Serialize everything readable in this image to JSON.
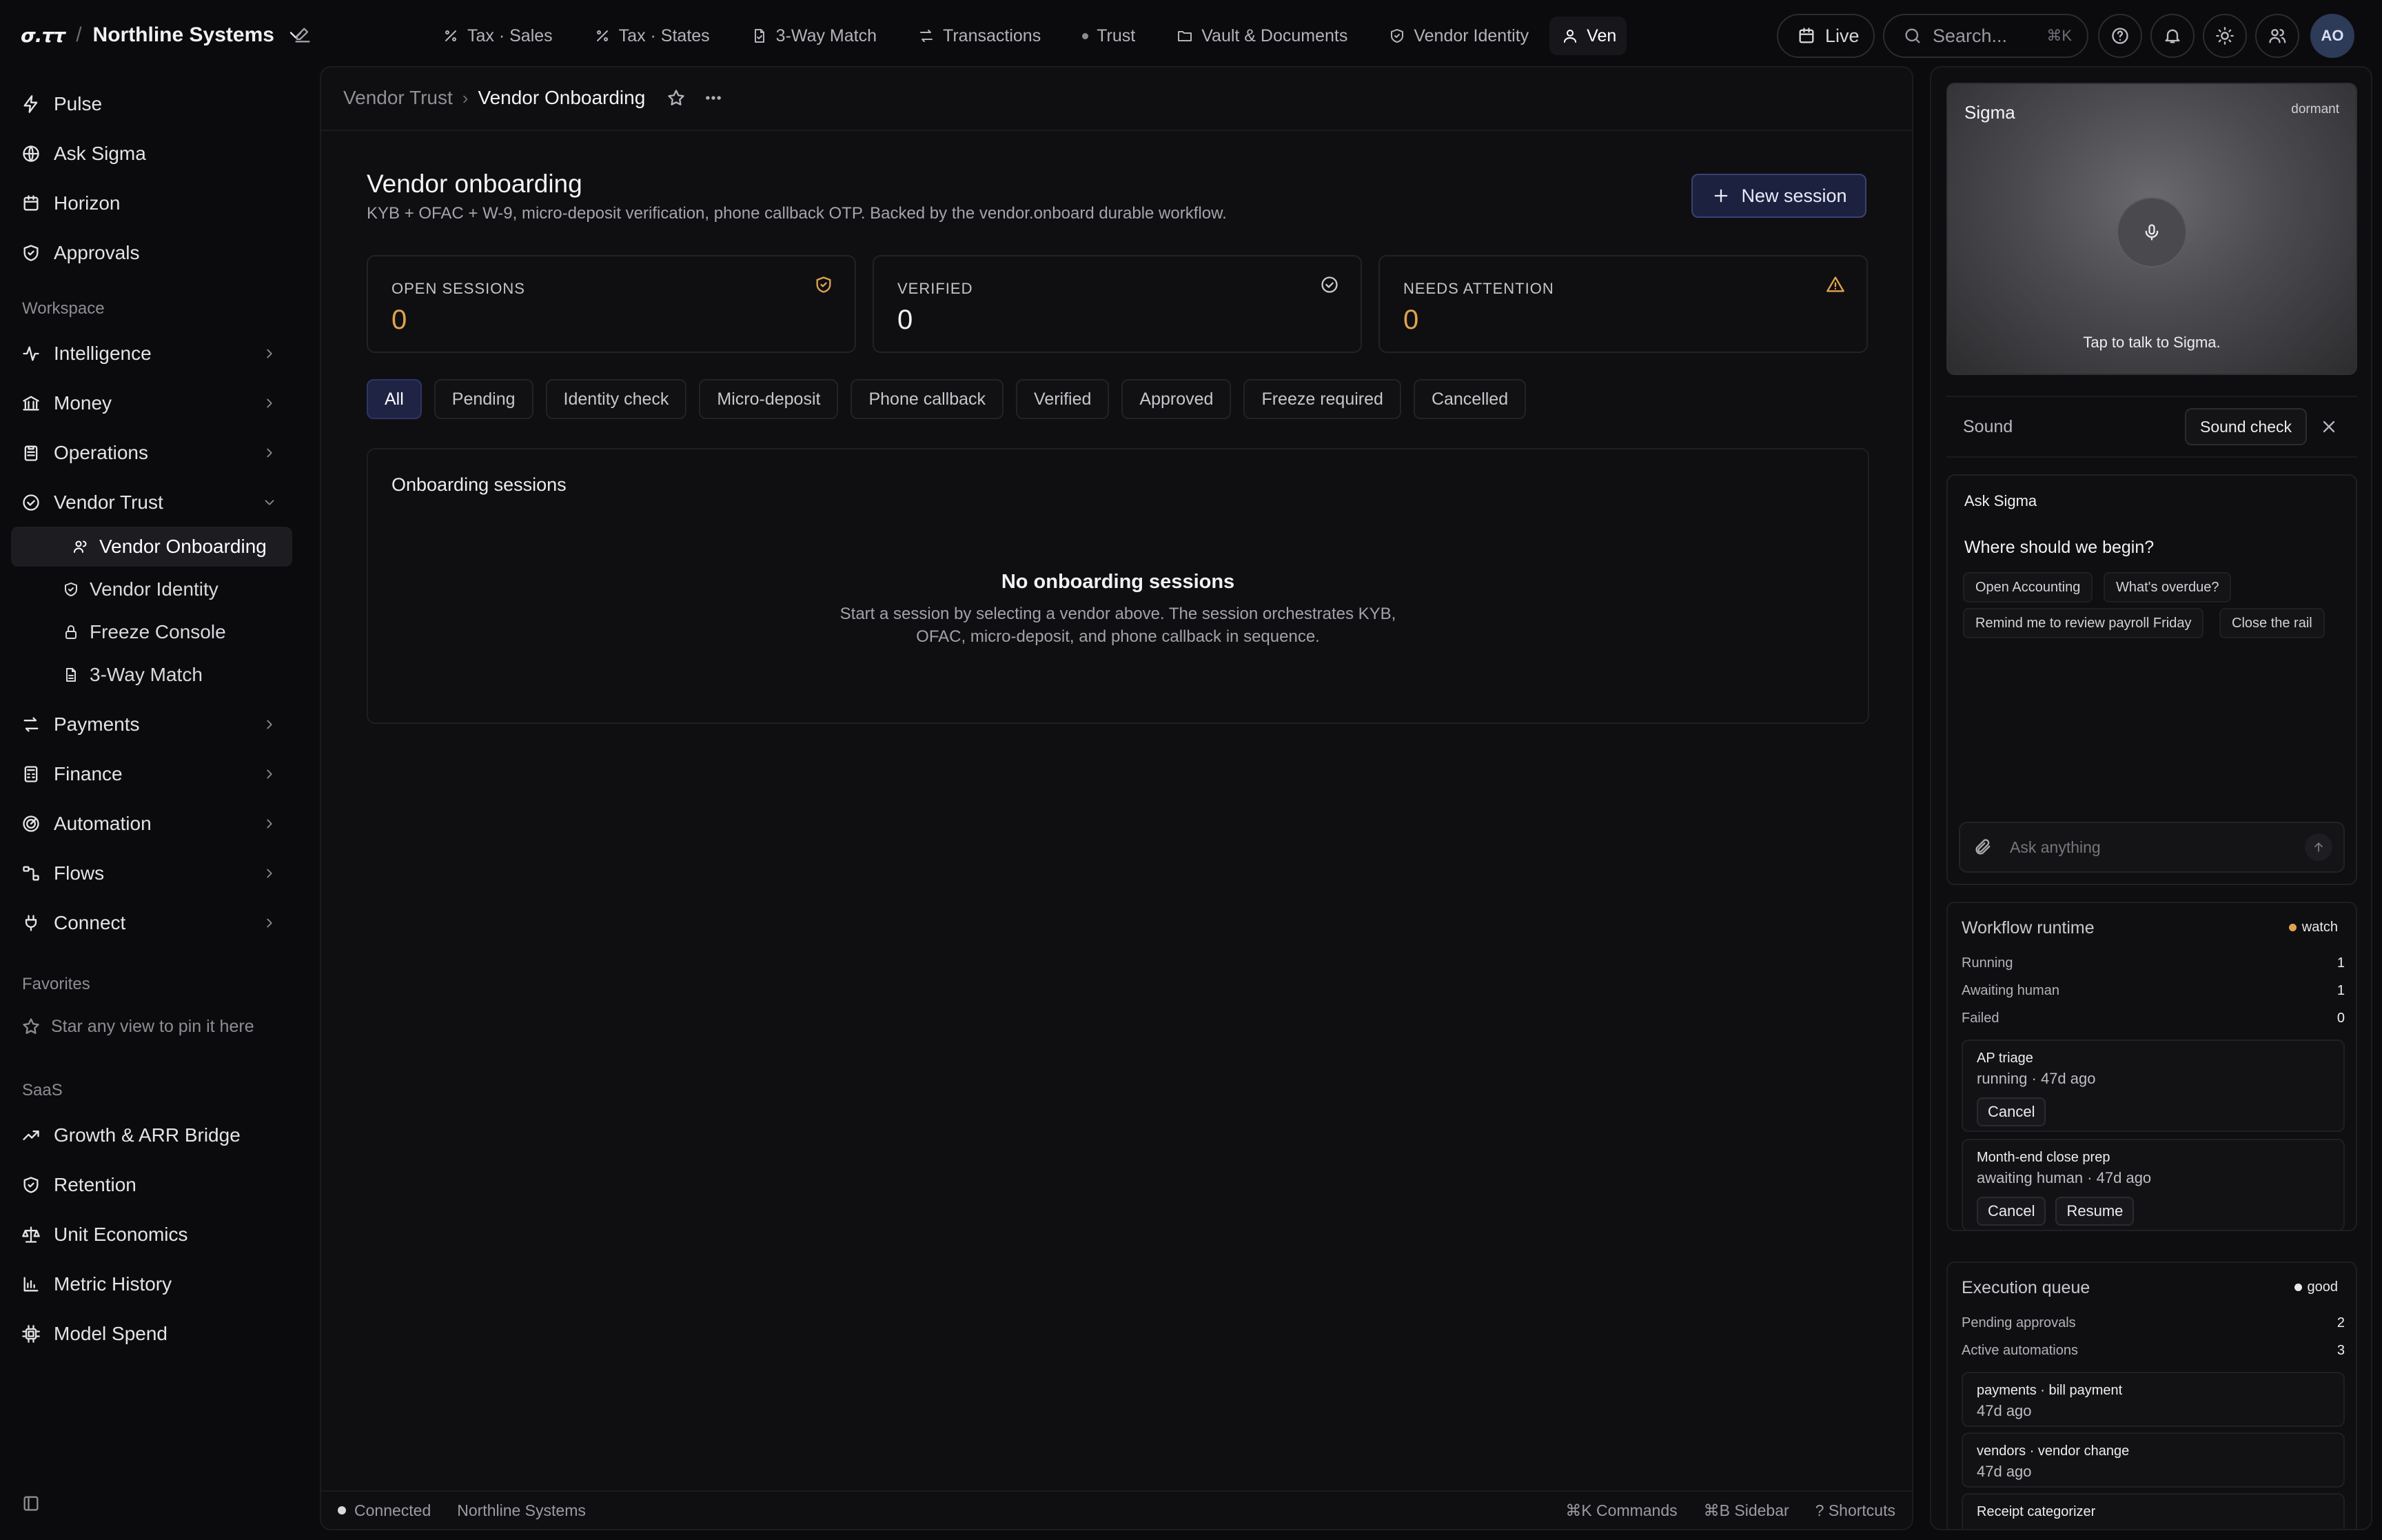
{
  "app": {
    "logo": "σ.ττ",
    "org_name": "Northline Systems"
  },
  "topnav": {
    "tabs": [
      {
        "label": "Tax · Sales",
        "icon": "percent-icon"
      },
      {
        "label": "Tax · States",
        "icon": "percent-icon"
      },
      {
        "label": "3-Way Match",
        "icon": "file-icon"
      },
      {
        "label": "Transactions",
        "icon": "arrows-icon"
      },
      {
        "label": "Trust",
        "icon": "dot-icon"
      },
      {
        "label": "Vault & Documents",
        "icon": "folder-icon"
      },
      {
        "label": "Vendor Identity",
        "icon": "shield-icon"
      },
      {
        "label": "Ven",
        "icon": "user-icon"
      }
    ],
    "live_label": "Live",
    "search_placeholder": "Search...",
    "search_shortcut": "⌘K",
    "avatar_initials": "AO"
  },
  "sidebar": {
    "top_items": [
      {
        "label": "Pulse",
        "icon": "bolt-icon"
      },
      {
        "label": "Ask Sigma",
        "icon": "sparkle-icon"
      },
      {
        "label": "Horizon",
        "icon": "calendar-icon"
      },
      {
        "label": "Approvals",
        "icon": "shield-check-icon"
      }
    ],
    "workspace_label": "Workspace",
    "workspace_items": [
      {
        "label": "Intelligence",
        "icon": "activity-icon"
      },
      {
        "label": "Money",
        "icon": "bank-icon"
      },
      {
        "label": "Operations",
        "icon": "clipboard-icon"
      },
      {
        "label": "Vendor Trust",
        "icon": "badge-check-icon"
      }
    ],
    "vendor_trust_children": [
      {
        "label": "Vendor Onboarding",
        "icon": "user-icon"
      },
      {
        "label": "Vendor Identity",
        "icon": "shield-icon"
      },
      {
        "label": "Freeze Console",
        "icon": "lock-icon"
      },
      {
        "label": "3-Way Match",
        "icon": "file-icon"
      }
    ],
    "more_items": [
      {
        "label": "Payments",
        "icon": "arrows-icon"
      },
      {
        "label": "Finance",
        "icon": "calculator-icon"
      },
      {
        "label": "Automation",
        "icon": "radar-icon"
      },
      {
        "label": "Flows",
        "icon": "workflow-icon"
      },
      {
        "label": "Connect",
        "icon": "plug-icon"
      }
    ],
    "favorites_label": "Favorites",
    "favorites_empty": "Star any view to pin it here",
    "saas_label": "SaaS",
    "saas_items": [
      {
        "label": "Growth & ARR Bridge",
        "icon": "trending-icon"
      },
      {
        "label": "Retention",
        "icon": "shield-icon"
      },
      {
        "label": "Unit Economics",
        "icon": "scale-icon"
      },
      {
        "label": "Metric History",
        "icon": "bar-chart-icon"
      },
      {
        "label": "Model Spend",
        "icon": "cpu-icon"
      }
    ]
  },
  "breadcrumb": {
    "parent": "Vendor Trust",
    "current": "Vendor Onboarding"
  },
  "page": {
    "title": "Vendor onboarding",
    "subtitle": "KYB + OFAC + W-9, micro-deposit verification, phone callback OTP. Backed by the vendor.onboard durable workflow.",
    "new_button": "New session"
  },
  "stats": [
    {
      "label": "OPEN SESSIONS",
      "value": "0",
      "icon": "shield-check-icon",
      "color": "#e0a44a"
    },
    {
      "label": "VERIFIED",
      "value": "0",
      "icon": "check-circle-icon",
      "color": "#f3f3f5"
    },
    {
      "label": "NEEDS ATTENTION",
      "value": "0",
      "icon": "warning-icon",
      "color": "#e0a44a"
    }
  ],
  "filters": [
    "All",
    "Pending",
    "Identity check",
    "Micro-deposit",
    "Phone callback",
    "Verified",
    "Approved",
    "Freeze required",
    "Cancelled"
  ],
  "sessions": {
    "header": "Onboarding sessions",
    "empty_title": "No onboarding sessions",
    "empty_text": "Start a session by selecting a vendor above. The session orchestrates KYB, OFAC, micro-deposit, and phone callback in sequence."
  },
  "footer": {
    "status": "Connected",
    "org": "Northline Systems",
    "commands": "⌘K Commands",
    "sidebar": "⌘B Sidebar",
    "shortcuts": "? Shortcuts"
  },
  "rail": {
    "sigma_name": "Sigma",
    "sigma_state": "dormant",
    "tap_text": "Tap to talk to Sigma.",
    "sound_label": "Sound",
    "sound_check": "Sound check",
    "ask_title": "Ask Sigma",
    "ask_question": "Where should we begin?",
    "suggestions": [
      "Open Accounting",
      "What's overdue?",
      "Remind me to review payroll Friday",
      "Close the rail"
    ],
    "ask_placeholder": "Ask anything",
    "workflow": {
      "title": "Workflow runtime",
      "badge": "watch",
      "badge_color": "#e0a44a",
      "rows": [
        {
          "label": "Running",
          "value": "1"
        },
        {
          "label": "Awaiting human",
          "value": "1"
        },
        {
          "label": "Failed",
          "value": "0"
        }
      ],
      "jobs": [
        {
          "name": "AP triage",
          "status": "running · 47d ago",
          "cancel": "Cancel"
        },
        {
          "name": "Month-end close prep",
          "status": "awaiting human · 47d ago",
          "cancel": "Cancel",
          "resume": "Resume"
        }
      ]
    },
    "queue": {
      "title": "Execution queue",
      "badge": "good",
      "badge_color": "#e8e8eb",
      "rows": [
        {
          "label": "Pending approvals",
          "value": "2"
        },
        {
          "label": "Active automations",
          "value": "3"
        }
      ],
      "items": [
        {
          "name": "payments · bill payment",
          "time": "47d ago"
        },
        {
          "name": "vendors · vendor change",
          "time": "47d ago"
        },
        {
          "name": "Receipt categorizer",
          "time": ""
        }
      ]
    }
  }
}
